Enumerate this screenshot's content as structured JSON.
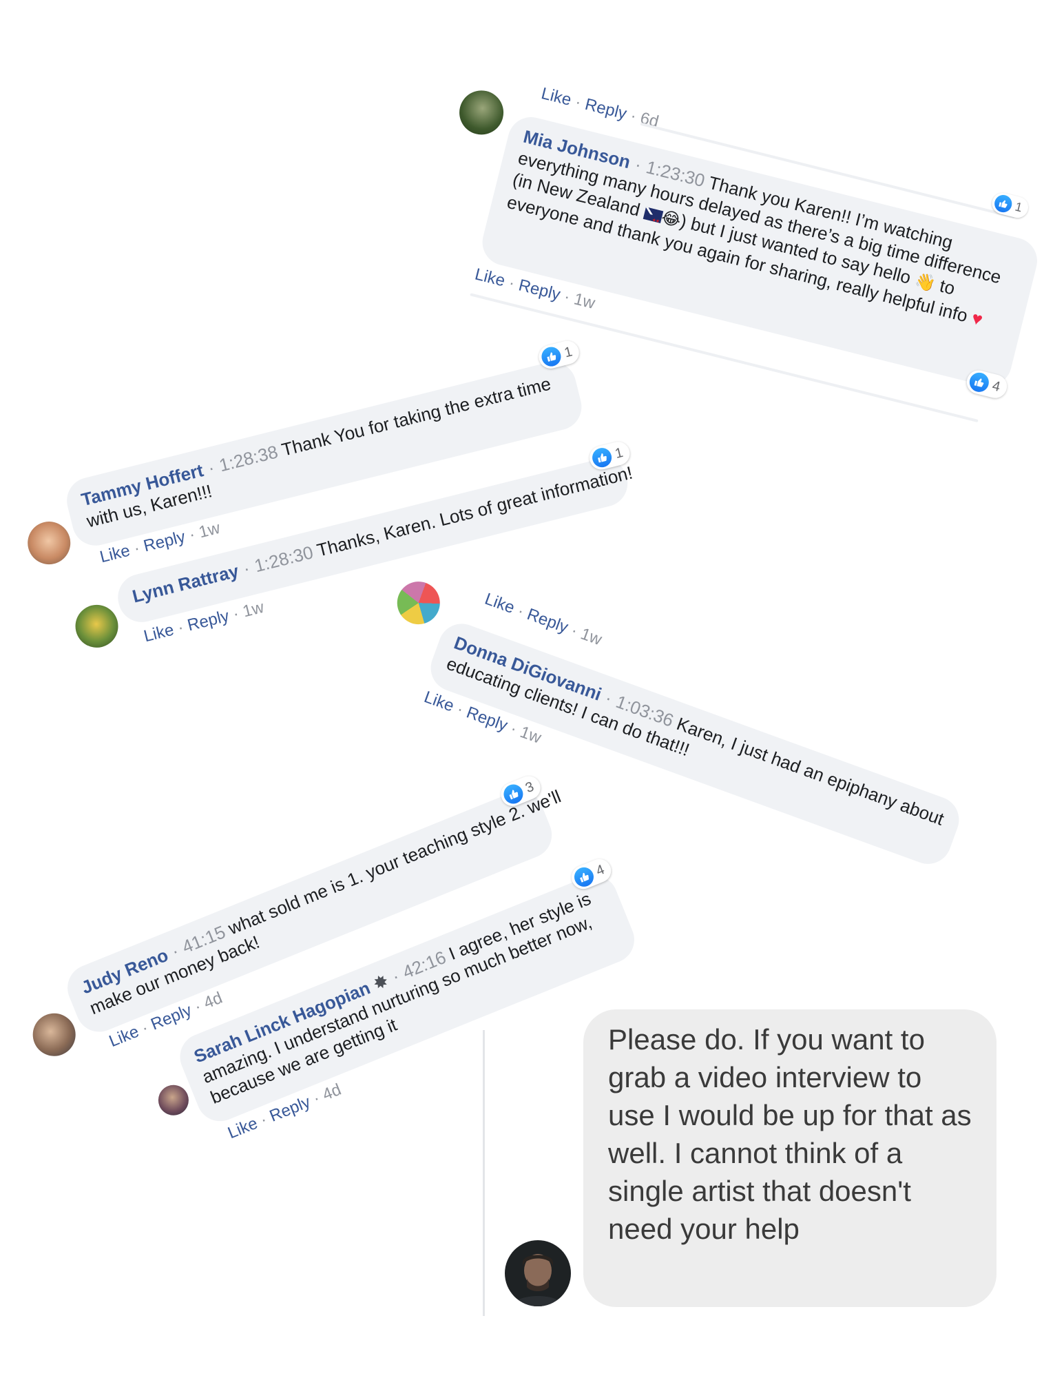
{
  "comments": [
    {
      "name": "Mia Johnson",
      "time": "1:23:30",
      "line1": "Thank you Karen!! I’m watching",
      "line2": "everything many hours delayed as there’s a big time difference",
      "line3a": "(in New Zealand",
      "line3b": ") but I just wanted to say hello",
      "line3c": "to",
      "line4": "everyone and thank you again for sharing, really helpful info",
      "likes": "4",
      "meta": {
        "like": "Like",
        "reply": "Reply",
        "age": "1w"
      }
    },
    {
      "name": "Tammy Hoffert",
      "time": "1:28:38",
      "line1": "Thank You for taking the extra time",
      "line2": "with us, Karen!!!",
      "likes": "1",
      "meta": {
        "like": "Like",
        "reply": "Reply",
        "age": "1w"
      }
    },
    {
      "name": "Lynn Rattray",
      "time": "1:28:30",
      "line1": "Thanks, Karen. Lots of great information!",
      "likes": "1",
      "meta": {
        "like": "Like",
        "reply": "Reply",
        "age": "1w"
      }
    },
    {
      "name": "Donna DiGiovanni",
      "time": "1:03:36",
      "line1": "Karen, I just had an epiphany about",
      "line2": "educating clients! I can do that!!!",
      "meta": {
        "like": "Like",
        "reply": "Reply",
        "age": "1w"
      }
    },
    {
      "name": "Judy Reno",
      "time": "41:15",
      "line1": "what sold me is 1. your teaching style 2. we'll",
      "line2": "make our money back!",
      "likes": "3",
      "meta": {
        "like": "Like",
        "reply": "Reply",
        "age": "4d"
      }
    },
    {
      "name": "Sarah Linck Hagopian",
      "time": "42:16",
      "line1": "I agree, her style is",
      "line2": "amazing. I understand nurturing so much better now,",
      "line3": "because we are getting it",
      "likes": "4",
      "meta": {
        "like": "Like",
        "reply": "Reply",
        "age": "4d"
      }
    }
  ],
  "top_meta": {
    "like": "Like",
    "reply": "Reply",
    "age": "6d"
  },
  "top_likes": "1",
  "donna_top_meta": {
    "like": "Like",
    "reply": "Reply",
    "age": "1w"
  },
  "dm": {
    "text": "Please do. If you want to grab a video interview to use I would be up for that as well. I cannot think of a single artist that doesn't need your help"
  }
}
